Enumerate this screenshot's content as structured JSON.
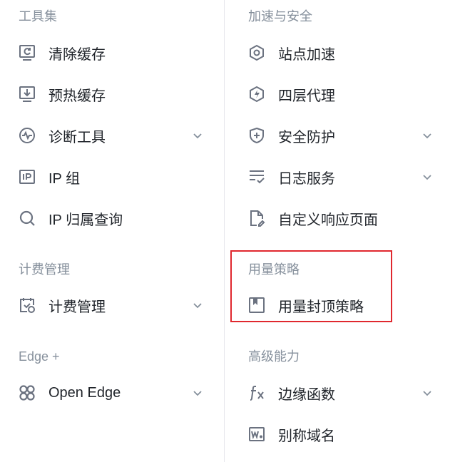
{
  "colors": {
    "accent_box": "#e0282e",
    "section_title": "#86909c",
    "text": "#1f2329",
    "icon": "#6b7280"
  },
  "left": {
    "sections": [
      {
        "title": "工具集",
        "items": [
          {
            "label": "清除缓存",
            "icon": "monitor-refresh-icon",
            "expandable": false
          },
          {
            "label": "预热缓存",
            "icon": "download-box-icon",
            "expandable": false
          },
          {
            "label": "诊断工具",
            "icon": "pulse-circle-icon",
            "expandable": true
          },
          {
            "label": "IP 组",
            "icon": "ip-box-icon",
            "expandable": false
          },
          {
            "label": "IP 归属查询",
            "icon": "search-icon",
            "expandable": false
          }
        ]
      },
      {
        "title": "计费管理",
        "items": [
          {
            "label": "计费管理",
            "icon": "calendar-check-icon",
            "expandable": true
          }
        ]
      },
      {
        "title": "Edge +",
        "items": [
          {
            "label": "Open Edge",
            "icon": "openedge-logo-icon",
            "expandable": true
          }
        ]
      }
    ]
  },
  "right": {
    "sections": [
      {
        "title": "加速与安全",
        "items": [
          {
            "label": "站点加速",
            "icon": "hexagon-gear-icon",
            "expandable": false
          },
          {
            "label": "四层代理",
            "icon": "hexagon-bolt-icon",
            "expandable": false
          },
          {
            "label": "安全防护",
            "icon": "shield-plus-icon",
            "expandable": true
          },
          {
            "label": "日志服务",
            "icon": "list-check-icon",
            "expandable": true
          },
          {
            "label": "自定义响应页面",
            "icon": "page-edit-icon",
            "expandable": false
          }
        ]
      },
      {
        "title": "用量策略",
        "items": [
          {
            "label": "用量封顶策略",
            "icon": "bookmark-box-icon",
            "expandable": false
          }
        ]
      },
      {
        "title": "高级能力",
        "items": [
          {
            "label": "边缘函数",
            "icon": "function-fx-icon",
            "expandable": true
          },
          {
            "label": "别称域名",
            "icon": "w-box-icon",
            "expandable": false
          }
        ]
      }
    ]
  }
}
